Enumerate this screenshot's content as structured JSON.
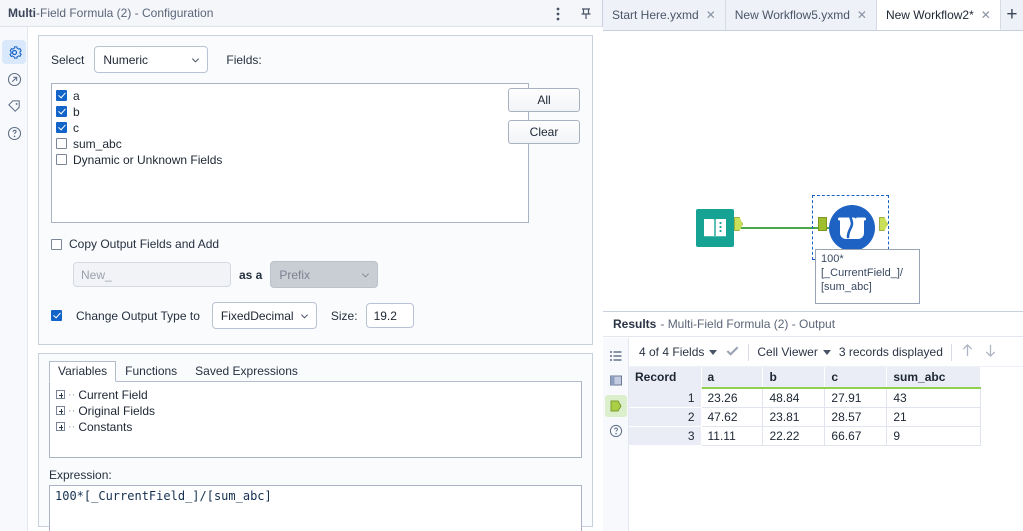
{
  "config": {
    "title_bold": "Multi",
    "title_rest": "-Field Formula (2) - Configuration",
    "rail": [
      {
        "name": "gear-icon",
        "label": "Configuration"
      },
      {
        "name": "arrow-circle-icon",
        "label": "Output"
      },
      {
        "name": "tag-icon",
        "label": "Annotation"
      },
      {
        "name": "question-circle-icon",
        "label": "Help"
      }
    ],
    "select_label": "Select",
    "select_value": "Numeric",
    "fields_label": "Fields:",
    "fields": [
      {
        "label": "a",
        "checked": true
      },
      {
        "label": "b",
        "checked": true
      },
      {
        "label": "c",
        "checked": true
      },
      {
        "label": "sum_abc",
        "checked": false
      },
      {
        "label": "Dynamic or Unknown Fields",
        "checked": false
      }
    ],
    "all_button": "All",
    "clear_button": "Clear",
    "copy_output_label": "Copy Output Fields and Add",
    "copy_output_checked": false,
    "new_field_value": "New_",
    "as_a_label": "as a",
    "prefix_value": "Prefix",
    "change_type_label": "Change Output Type to",
    "change_type_checked": true,
    "output_type": "FixedDecimal",
    "size_label": "Size:",
    "size_value": "19.2",
    "tabs": [
      {
        "label": "Variables",
        "active": true
      },
      {
        "label": "Functions",
        "active": false
      },
      {
        "label": "Saved Expressions",
        "active": false
      }
    ],
    "tree": [
      "Current Field",
      "Original Fields",
      "Constants"
    ],
    "expression_label": "Expression:",
    "expression_value": "100*[_CurrentField_]/[sum_abc]"
  },
  "workflow_tabs": [
    {
      "label": "Start Here.yxmd",
      "active": false
    },
    {
      "label": "New Workflow5.yxmd",
      "active": false
    },
    {
      "label": "New Workflow2*",
      "active": true
    }
  ],
  "add_tab_label": "+",
  "canvas": {
    "input_tool_name": "input-data-tool",
    "formula_tool_name": "multi-field-formula-tool",
    "annotation_lines": [
      "100*",
      "[_CurrentField_]/",
      "[sum_abc]"
    ]
  },
  "results": {
    "title_bold": "Results",
    "title_rest": "- Multi-Field Formula (2) - Output",
    "rail": [
      {
        "name": "list-icon"
      },
      {
        "name": "card-view-icon"
      },
      {
        "name": "output-anchor-icon"
      },
      {
        "name": "question-circle-icon"
      }
    ],
    "fields_selector": "4 of 4 Fields",
    "cell_viewer": "Cell Viewer",
    "records_displayed": "3 records displayed",
    "columns": [
      "Record",
      "a",
      "b",
      "c",
      "sum_abc"
    ],
    "rows": [
      [
        "1",
        "23.26",
        "48.84",
        "27.91",
        "43"
      ],
      [
        "2",
        "47.62",
        "23.81",
        "28.57",
        "21"
      ],
      [
        "3",
        "11.11",
        "22.22",
        "66.67",
        "9"
      ]
    ]
  },
  "colors": {
    "accent_blue": "#1763c4",
    "anchor_green": "#cbe05a",
    "input_teal": "#18a08c",
    "header_green": "#8fd14f"
  }
}
